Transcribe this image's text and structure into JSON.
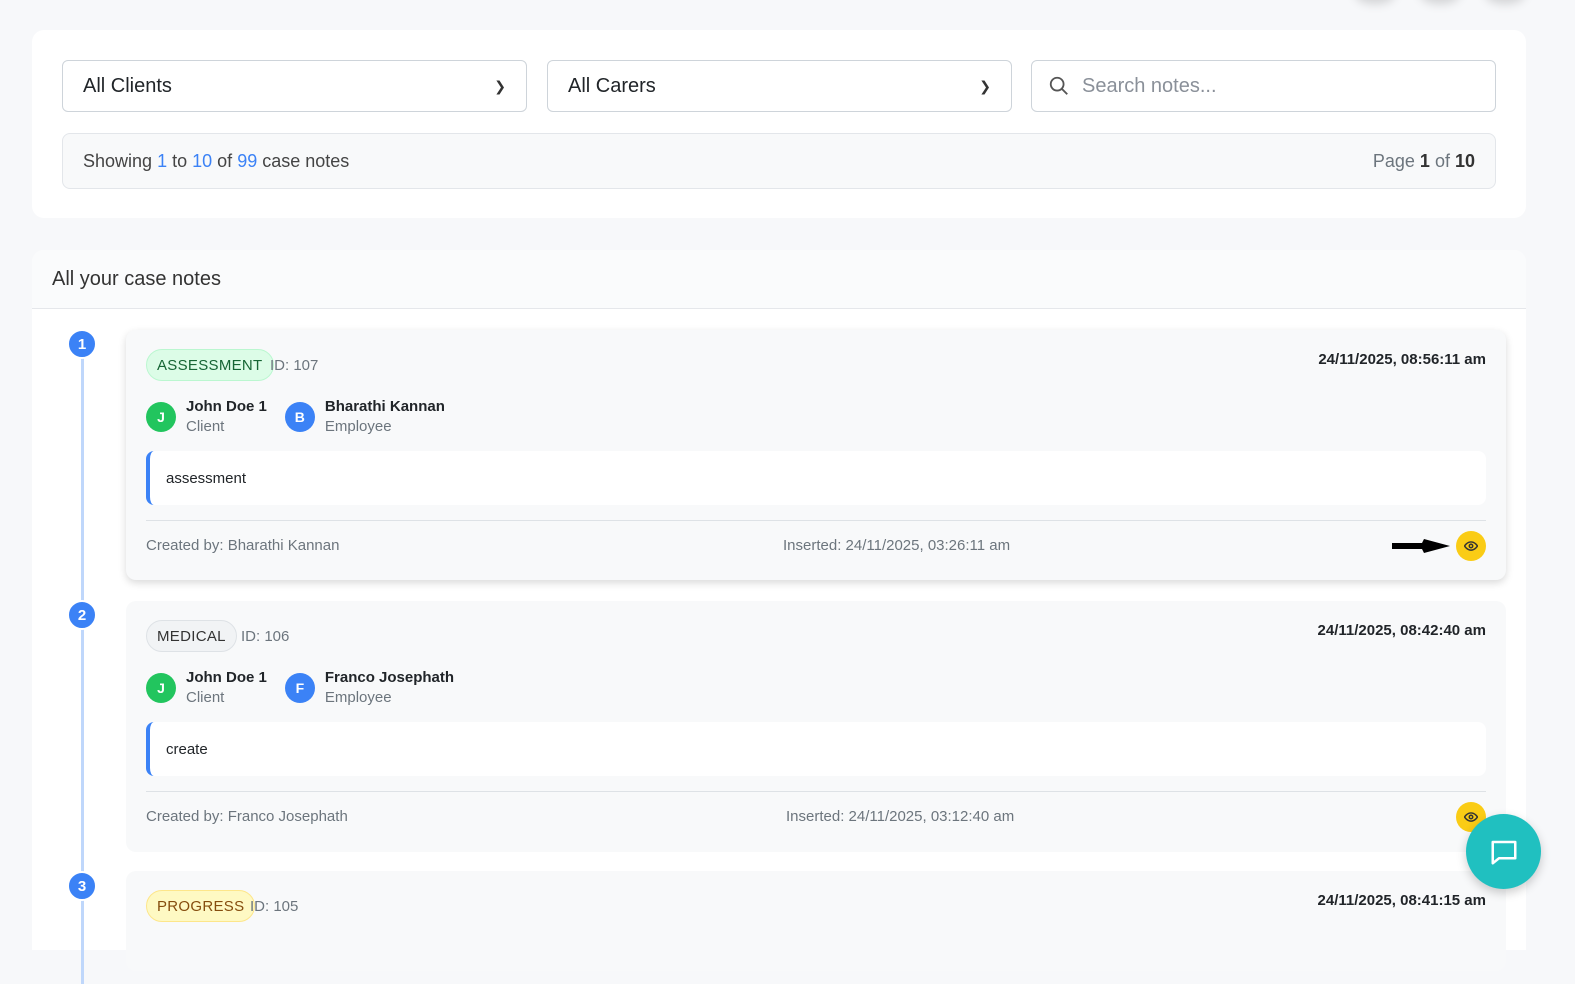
{
  "filters": {
    "client_select": "All Clients",
    "carer_select": "All Carers",
    "search_placeholder": "Search notes..."
  },
  "summary": {
    "showing": "Showing",
    "from": "1",
    "to_word": "to",
    "to": "10",
    "of_word": "of",
    "total": "99",
    "suffix": "case notes",
    "page_word": "Page",
    "page": "1",
    "page_of": "of",
    "pages": "10"
  },
  "section_title": "All your case notes",
  "notes": [
    {
      "index": "1",
      "type": "ASSESSMENT",
      "id": "ID: 107",
      "date": "24/11/2025, 08:56:11 am",
      "client": {
        "initial": "J",
        "name": "John Doe 1",
        "role": "Client"
      },
      "employee": {
        "initial": "B",
        "name": "Bharathi Kannan",
        "role": "Employee"
      },
      "text": "assessment",
      "created_by": "Created by: Bharathi Kannan",
      "inserted": "Inserted: 24/11/2025, 03:26:11 am"
    },
    {
      "index": "2",
      "type": "MEDICAL",
      "id": "ID: 106",
      "date": "24/11/2025, 08:42:40 am",
      "client": {
        "initial": "J",
        "name": "John Doe 1",
        "role": "Client"
      },
      "employee": {
        "initial": "F",
        "name": "Franco Josephath",
        "role": "Employee"
      },
      "text": "create",
      "created_by": "Created by: Franco Josephath",
      "inserted": "Inserted: 24/11/2025, 03:12:40 am"
    },
    {
      "index": "3",
      "type": "PROGRESS",
      "id": "ID: 105",
      "date": "24/11/2025, 08:41:15 am"
    }
  ],
  "colors": {
    "accent": "#3b82f6",
    "client_avatar": "#22c55e",
    "view_button": "#facc15",
    "chat": "#20c0c0"
  }
}
